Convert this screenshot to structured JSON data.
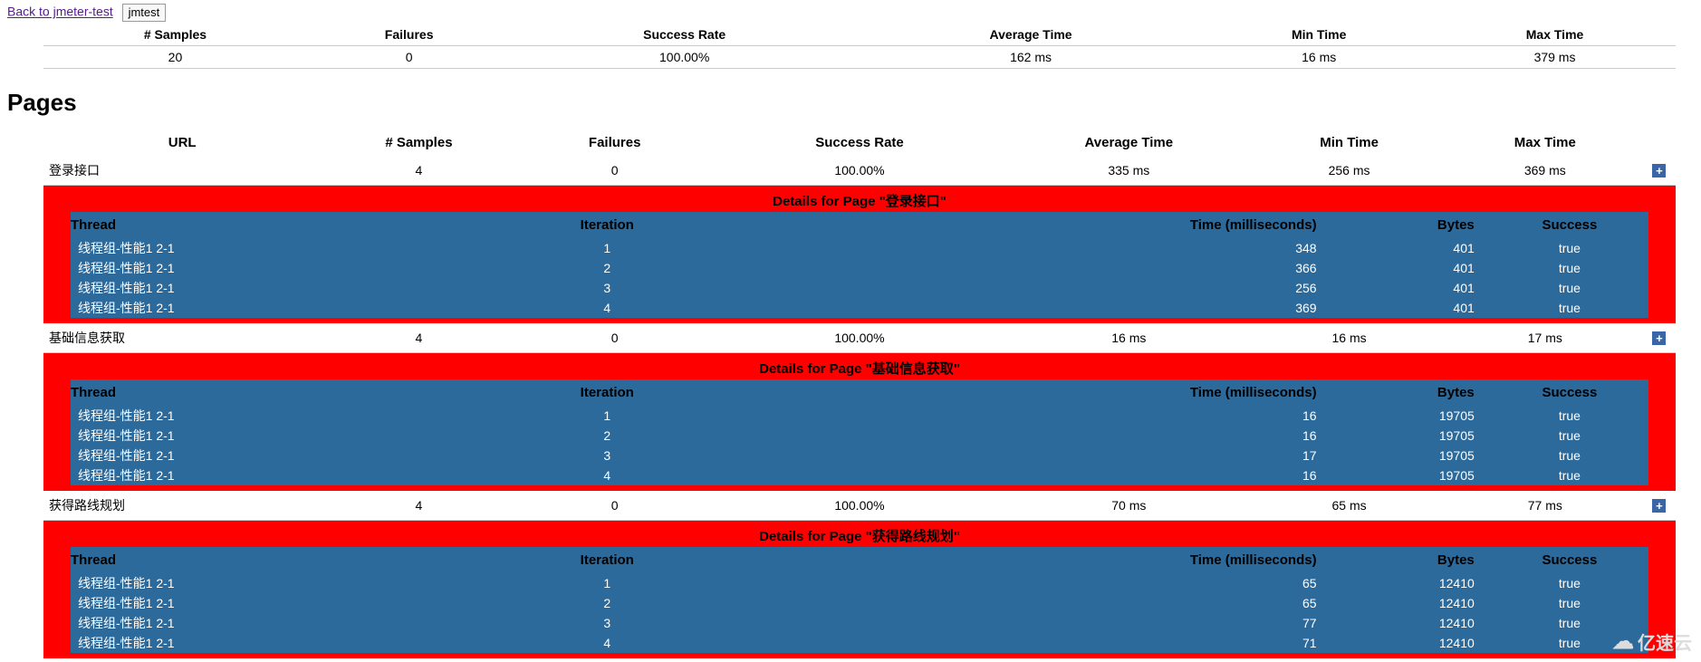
{
  "nav": {
    "back_link": "Back to jmeter-test",
    "tab_label": "jmtest"
  },
  "summary": {
    "headers": [
      "# Samples",
      "Failures",
      "Success Rate",
      "Average Time",
      "Min Time",
      "Max Time"
    ],
    "row": {
      "samples": "20",
      "failures": "0",
      "rate": "100.00%",
      "avg": "162 ms",
      "min": "16 ms",
      "max": "379 ms"
    }
  },
  "pages_heading": "Pages",
  "pages_headers": {
    "url": "URL",
    "samples": "# Samples",
    "failures": "Failures",
    "rate": "Success Rate",
    "avg": "Average Time",
    "min": "Min Time",
    "max": "Max Time"
  },
  "details_prefix": "Details for Page \"",
  "details_suffix": "\"",
  "inner_headers": {
    "thread": "Thread",
    "iteration": "Iteration",
    "time": "Time (milliseconds)",
    "bytes": "Bytes",
    "success": "Success"
  },
  "pages": [
    {
      "url": "登录接口",
      "samples": "4",
      "failures": "0",
      "rate": "100.00%",
      "avg": "335 ms",
      "min": "256 ms",
      "max": "369 ms",
      "rows": [
        {
          "thread": "线程组-性能1 2-1",
          "iter": "1",
          "time": "348",
          "bytes": "401",
          "success": "true"
        },
        {
          "thread": "线程组-性能1 2-1",
          "iter": "2",
          "time": "366",
          "bytes": "401",
          "success": "true"
        },
        {
          "thread": "线程组-性能1 2-1",
          "iter": "3",
          "time": "256",
          "bytes": "401",
          "success": "true"
        },
        {
          "thread": "线程组-性能1 2-1",
          "iter": "4",
          "time": "369",
          "bytes": "401",
          "success": "true"
        }
      ]
    },
    {
      "url": "基础信息获取",
      "samples": "4",
      "failures": "0",
      "rate": "100.00%",
      "avg": "16 ms",
      "min": "16 ms",
      "max": "17 ms",
      "rows": [
        {
          "thread": "线程组-性能1 2-1",
          "iter": "1",
          "time": "16",
          "bytes": "19705",
          "success": "true"
        },
        {
          "thread": "线程组-性能1 2-1",
          "iter": "2",
          "time": "16",
          "bytes": "19705",
          "success": "true"
        },
        {
          "thread": "线程组-性能1 2-1",
          "iter": "3",
          "time": "17",
          "bytes": "19705",
          "success": "true"
        },
        {
          "thread": "线程组-性能1 2-1",
          "iter": "4",
          "time": "16",
          "bytes": "19705",
          "success": "true"
        }
      ]
    },
    {
      "url": "获得路线规划",
      "samples": "4",
      "failures": "0",
      "rate": "100.00%",
      "avg": "70 ms",
      "min": "65 ms",
      "max": "77 ms",
      "rows": [
        {
          "thread": "线程组-性能1 2-1",
          "iter": "1",
          "time": "65",
          "bytes": "12410",
          "success": "true"
        },
        {
          "thread": "线程组-性能1 2-1",
          "iter": "2",
          "time": "65",
          "bytes": "12410",
          "success": "true"
        },
        {
          "thread": "线程组-性能1 2-1",
          "iter": "3",
          "time": "77",
          "bytes": "12410",
          "success": "true"
        },
        {
          "thread": "线程组-性能1 2-1",
          "iter": "4",
          "time": "71",
          "bytes": "12410",
          "success": "true"
        }
      ]
    }
  ],
  "expand_glyph": "+",
  "watermark": "亿速云"
}
